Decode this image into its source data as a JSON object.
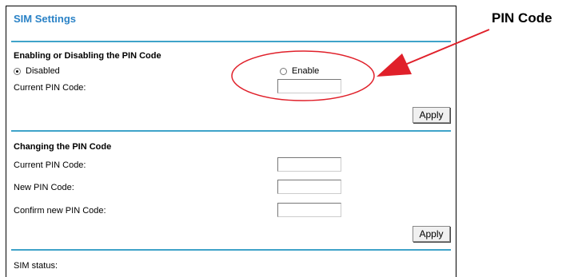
{
  "panel": {
    "title": "SIM Settings",
    "pin_toggle": {
      "heading": "Enabling or Disabling the PIN Code",
      "option_disabled": "Disabled",
      "option_enable": "Enable",
      "selected": "Disabled",
      "current_pin_label": "Current PIN Code:",
      "current_pin_value": "",
      "apply_label": "Apply"
    },
    "change_pin": {
      "heading": "Changing the PIN Code",
      "current_pin_label": "Current PIN Code:",
      "current_pin_value": "",
      "new_pin_label": "New PIN Code:",
      "new_pin_value": "",
      "confirm_pin_label": "Confirm new PIN Code:",
      "confirm_pin_value": "",
      "apply_label": "Apply"
    },
    "status": {
      "label": "SIM status:"
    }
  },
  "annotation": {
    "label": "PIN Code",
    "color": "#e0202a"
  },
  "colors": {
    "title": "#2a82c6",
    "rule": "#3fa3c9"
  }
}
